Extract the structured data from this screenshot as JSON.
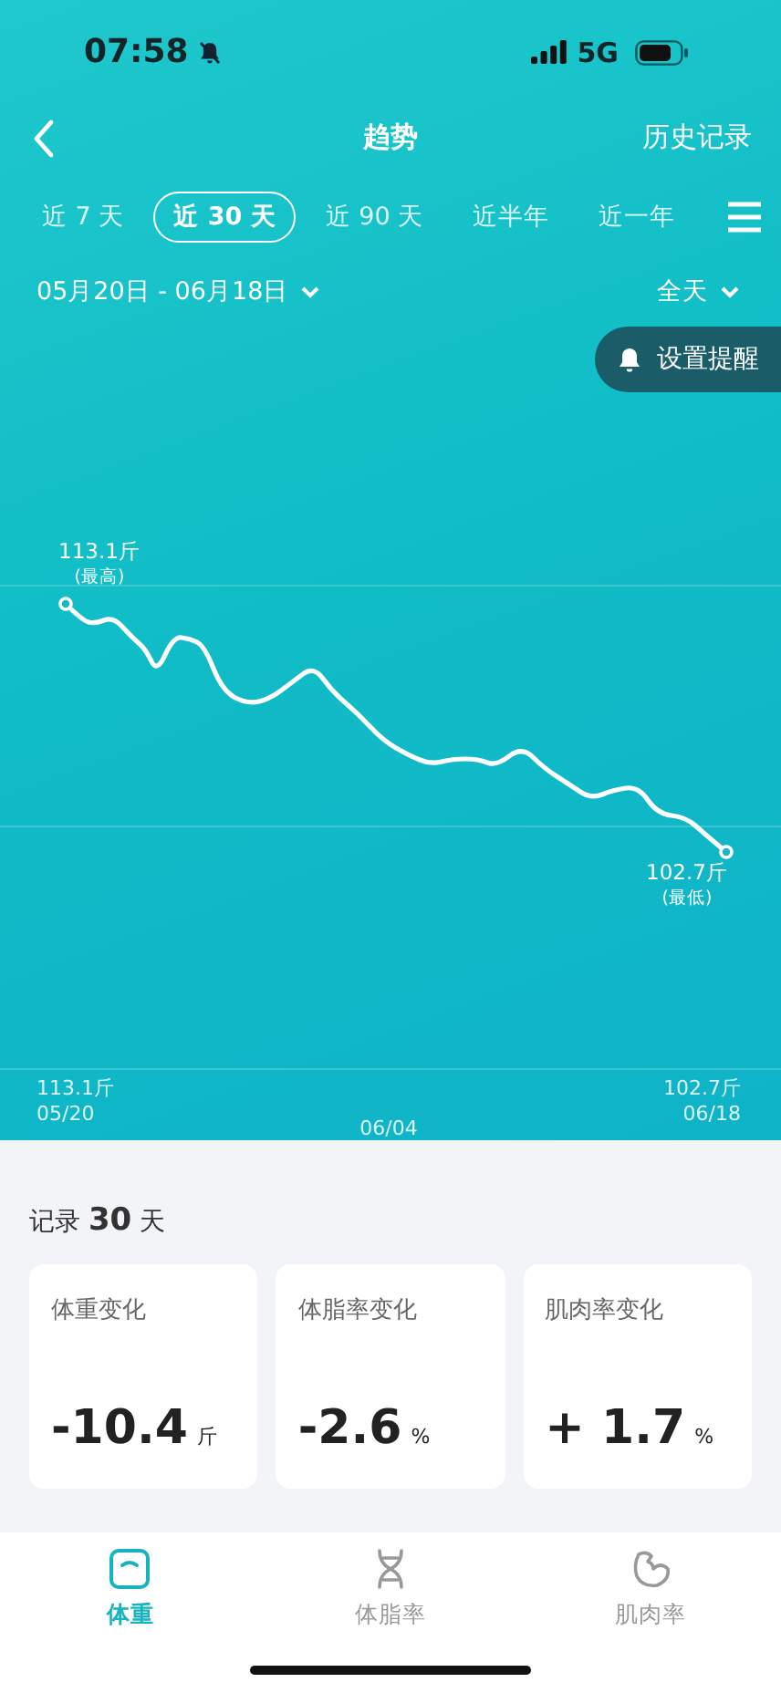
{
  "status_bar": {
    "time": "07:58",
    "network": "5G"
  },
  "nav": {
    "title": "趋势",
    "action": "历史记录"
  },
  "periods": [
    {
      "label": "近 7 天",
      "selected": false
    },
    {
      "label": "近 30 天",
      "selected": true
    },
    {
      "label": "近 90 天",
      "selected": false
    },
    {
      "label": "近半年",
      "selected": false
    },
    {
      "label": "近一年",
      "selected": false
    }
  ],
  "filters": {
    "date_range": "05月20日 - 06月18日",
    "time_of_day": "全天"
  },
  "reminder_button": "设置提醒",
  "chart": {
    "max_value": "113.1斤",
    "max_note": "(最高)",
    "min_value": "102.7斤",
    "min_note": "(最低)",
    "start_value": "113.1斤",
    "start_date": "05/20",
    "mid_date": "06/04",
    "end_value": "102.7斤",
    "end_date": "06/18"
  },
  "summary": {
    "prefix": "记录",
    "count": "30",
    "suffix": "天"
  },
  "cards": [
    {
      "title": "体重变化",
      "value": "-10.4",
      "unit": "斤"
    },
    {
      "title": "体脂率变化",
      "value": "-2.6",
      "unit": "%"
    },
    {
      "title": "肌肉率变化",
      "value": "+ 1.7",
      "unit": "%"
    }
  ],
  "bottom_tabs": [
    {
      "kind": "scale",
      "label": "体重",
      "selected": true
    },
    {
      "kind": "fat",
      "label": "体脂率",
      "selected": false
    },
    {
      "kind": "muscle",
      "label": "肌肉率",
      "selected": false
    }
  ]
}
